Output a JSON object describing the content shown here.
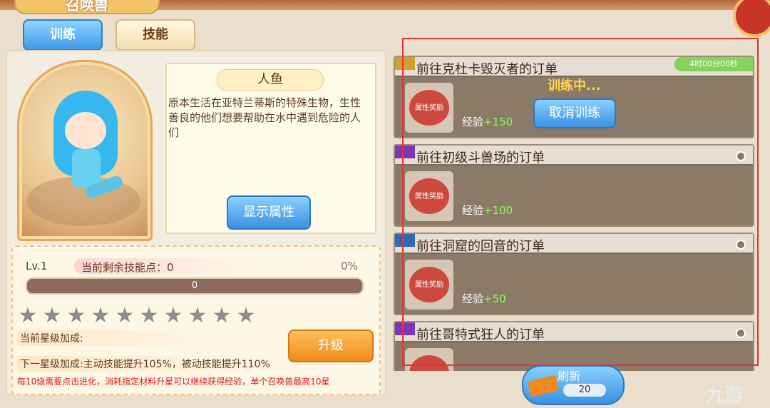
{
  "header": {
    "title": "召唤兽"
  },
  "tabs": [
    {
      "label": "训练",
      "active": true
    },
    {
      "label": "技能",
      "active": false
    }
  ],
  "pet": {
    "name": "人鱼",
    "description": "原本生活在亚特兰蒂斯的特殊生物，生性善良的他们想要帮助在水中遇到危险的人们",
    "show_attr_label": "显示属性"
  },
  "progress": {
    "level": "Lv.1",
    "skill_points": "当前剩余技能点：0",
    "percent": "0%",
    "bar_value": "0",
    "fill_fraction": 0
  },
  "stars": {
    "total": 10,
    "filled": 0
  },
  "star_bonus": {
    "current": "当前星级加成:",
    "next": "下一星级加成:主动技能提升105%，被动技能提升110%",
    "rule": "每10级需要点击进化，消耗指定材料升星可以继续获得经验，单个召唤兽最高10星",
    "upgrade_label": "升级"
  },
  "quests": [
    {
      "tag": "",
      "title": "前往克杜卡毁灭者的订单",
      "exp_label": "经验",
      "exp_value": "+150",
      "reward_label": "属性奖励",
      "timer": "4时00分00秒",
      "status": "训练中...",
      "cancel_label": "取消训练",
      "tag_color": "#d0a030"
    },
    {
      "tag": "",
      "title": "前往初级斗兽场的订单",
      "exp_label": "经验",
      "exp_value": "+100",
      "reward_label": "属性奖励",
      "tag_color": "#7a36b8"
    },
    {
      "tag": "",
      "title": "前往洞窟的回音的订单",
      "exp_label": "经验",
      "exp_value": "+50",
      "reward_label": "属性奖励",
      "tag_color": "#2e6ab8"
    },
    {
      "tag": "",
      "title": "前往哥特式狂人的订单",
      "exp_label": "经验",
      "exp_value": "",
      "reward_label": "",
      "tag_color": "#7a36b8"
    }
  ],
  "refresh": {
    "label": "刷新",
    "cost": "20"
  },
  "watermark": "九游",
  "colors": {
    "accent_blue": "#3c90e0",
    "accent_orange": "#f08a1c",
    "exp_green": "#8aff5a",
    "highlight_red": "#e23434"
  }
}
